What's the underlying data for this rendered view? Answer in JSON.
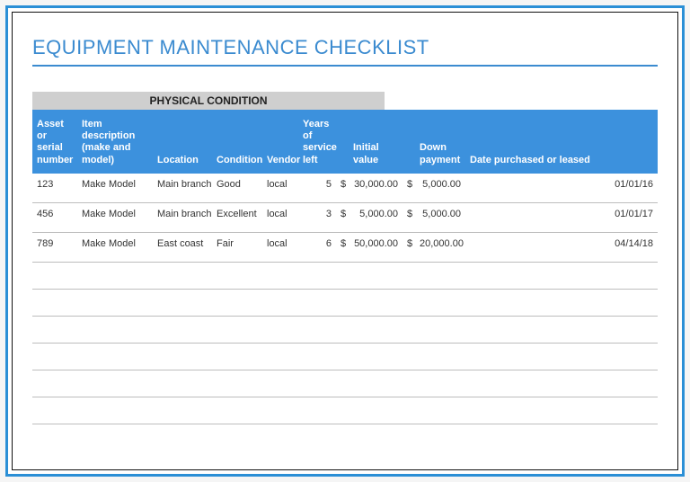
{
  "title": "EQUIPMENT MAINTENANCE CHECKLIST",
  "section_label": "PHYSICAL CONDITION",
  "headers": {
    "asset": "Asset or serial number",
    "item": "Item description (make and model)",
    "location": "Location",
    "condition": "Condition",
    "vendor": "Vendor",
    "years": "Years of service left",
    "initial": "Initial value",
    "down": "Down payment",
    "date": "Date purchased or leased"
  },
  "currency_symbol": "$",
  "rows": [
    {
      "asset": "123",
      "item": "Make Model",
      "location": "Main branch",
      "condition": "Good",
      "vendor": "local",
      "years": "5",
      "initial": "30,000.00",
      "down": "5,000.00",
      "date": "01/01/16"
    },
    {
      "asset": "456",
      "item": "Make Model",
      "location": "Main branch",
      "condition": "Excellent",
      "vendor": "local",
      "years": "3",
      "initial": "5,000.00",
      "down": "5,000.00",
      "date": "01/01/17"
    },
    {
      "asset": "789",
      "item": "Make Model",
      "location": "East coast",
      "condition": "Fair",
      "vendor": "local",
      "years": "6",
      "initial": "50,000.00",
      "down": "20,000.00",
      "date": "04/14/18"
    }
  ],
  "empty_rows": 6
}
